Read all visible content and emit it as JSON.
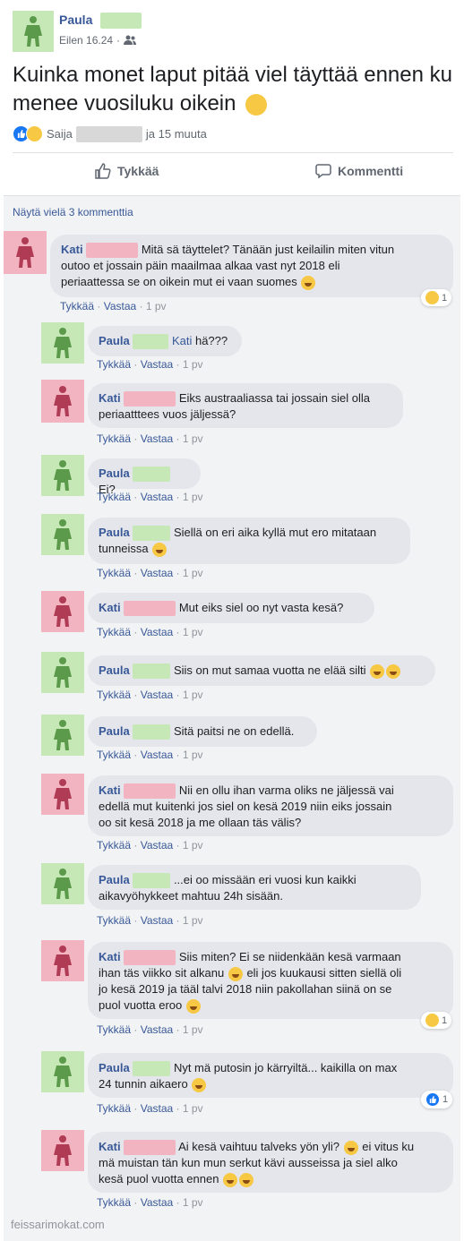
{
  "post": {
    "author": "Paula",
    "time": "Eilen 16.24",
    "privacy_separator": "·",
    "text": "Kuinka monet laput pitää viel täyttää ennen ku menee vuosiluku oikein",
    "reaction_name": "Saija",
    "reaction_others": "ja 15 muuta"
  },
  "actions": {
    "like": "Tykkää",
    "comment": "Kommentti"
  },
  "more_comments": "Näytä vielä 3 kommenttia",
  "meta": {
    "like": "Tykkää",
    "reply": "Vastaa",
    "sep": "·",
    "time": "1 pv"
  },
  "comments": [
    {
      "author": "Kati",
      "line1": "Mitä sä täyttelet? Tänään just keilailin miten vitun",
      "line2": "outoo et jossain päin maailmaa alkaa vast nyt 2018 eli",
      "line3": "periaattessa se on oikein mut ei vaan suomes",
      "reaction_count": "1"
    },
    {
      "author": "Paula",
      "mention": "Kati",
      "text": "hä???"
    },
    {
      "author": "Kati",
      "line1": "Eiks austraaliassa tai jossain siel olla",
      "line2": "periaatttees vuos jäljessä?"
    },
    {
      "author": "Paula",
      "text": "Ei?"
    },
    {
      "author": "Paula",
      "line1": "Siellä on eri aika kyllä mut ero mitataan",
      "line2": "tunneissa"
    },
    {
      "author": "Kati",
      "text": "Mut eiks siel oo nyt vasta kesä?"
    },
    {
      "author": "Paula",
      "text": "Siis on mut samaa vuotta ne elää silti"
    },
    {
      "author": "Paula",
      "text": "Sitä paitsi ne on edellä."
    },
    {
      "author": "Kati",
      "line1": "Nii en ollu ihan varma oliks ne jäljessä vai",
      "line2": "edellä mut kuitenki jos siel on kesä 2019 niin eiks jossain",
      "line3": "oo sit kesä 2018 ja me ollaan täs välis?"
    },
    {
      "author": "Paula",
      "line1": "...ei oo missään eri vuosi kun kaikki",
      "line2": "aikavyöhykkeet mahtuu 24h sisään."
    },
    {
      "author": "Kati",
      "line1": "Siis miten? Ei se niidenkään kesä varmaan",
      "line2a": "ihan täs viikko sit alkanu",
      "line2b": "eli jos kuukausi sitten siellä oli",
      "line3": "jo kesä 2019 ja tääl talvi 2018 niin pakollahan siinä on se",
      "line4": "puol vuotta eroo",
      "reaction_count": "1"
    },
    {
      "author": "Paula",
      "line1": "Nyt mä putosin jo kärryiltä... kaikilla on max",
      "line2": "24 tunnin aikaero",
      "reaction_count": "1"
    },
    {
      "author": "Kati",
      "line1a": "Ai kesä vaihtuu talveks yön yli?",
      "line1b": "ei vitus ku",
      "line2": "mä muistan tän kun mun serkut kävi ausseissa ja siel alko",
      "line3": "kesä puol vuotta ennen"
    }
  ],
  "watermark": "feissarimokat.com",
  "colors": {
    "link": "#385898",
    "bubble": "#e4e6eb",
    "green_redact": "#c6e7b6",
    "pink_redact": "#f2b4c0"
  }
}
